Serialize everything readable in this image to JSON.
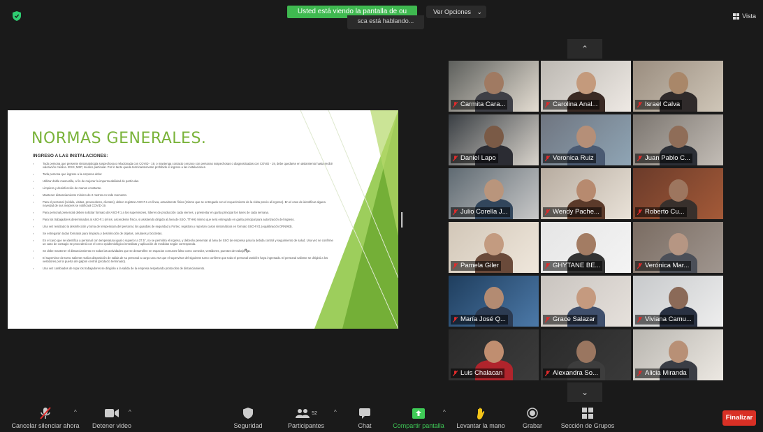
{
  "top": {
    "share_banner": "Usted está viendo la pantalla de ou",
    "share_sub": "sca está hablando...",
    "view_options": "Ver Opciones",
    "view": "Vista"
  },
  "slide": {
    "title": "NORMAS GENERALES.",
    "subtitle": "INGRESO A LAS INSTALACIONES:",
    "bullets": [
      "Todo persona que presente sintomatología sospechosa o relacionada con COVID - 19, o mantenga contacto cercano con personas sospechosas o diagnosticadas con COVID - 19, debe quedarse en aislamiento hasta recibir valoración médica. IESS, MSP, médico particular. Por lo tanto queda terminantemente prohibido el ingreso a las instalaciones.",
      "Toda persona que ingrese a la empresa debe:",
      "Utilizar doble mascarilla, a fin de mejorar la impermeabilidad de partículas.",
      "Limpieza y desinfección de manos constante.",
      "Mantener distanciamiento mínimo de 2 metros en todo momento.",
      "Para el personal (cédula, visitas, proveedores, clientes), deben registrar ASO-F.1 en línea, actualmente físico (mismo que se entregado con el requerimiento de la visita previo al ingreso). En el caso de identificar alguna novedad de sus mejores se notificará COVID-19.",
      "Para personal presencial deben solicitar formato del ASO-F.1 a los supervisores, líderes de producción cada viernes, y presentar en garita principal los lunes de cada semana.",
      "Para los trabajadores determinados al ASO-F.1 (el ins. ascendente físico, si asistiendo dirigido al área de SSO, TTHH) mismo que será entregado en garita principal para autorización del ingreso.",
      "Una vez realizado la desinfección y toma de temperatura del personal, los guardias de seguridad y Fortec, registran y reportan casos sintomáticos en formato SSO-F.01 (equilibración DRN993).",
      "Se entregarán todas formatos para limpieza y desinfección de objetos, celulares y bicicletas.",
      "En el caso que se identifica a personal con temperatura igual o superior a 37.5°, no se permitirá el ingreso, y deberán presentar al área de SSO de empresa para la debida control y seguimiento de salud. Una vez se confirme un caso de contagio se procederá con el cerco epidemiológico inmediato y aplicación de medidas según corresponda.",
      "Se debe mantener el distanciamiento en todas las actividades que se desarrollen en espacios comunes falso como comedor, vestidores, puestos de trabajo, etc.",
      "El supervisor de turno saliente realiza disposición de salida de su personal a cargo una vez que el supervisor del siguiente turno confirme que todo el personal también haya ingresado. El personal saliente se dirigirá a los vestidores por la puerta del galpón central (producto terminado).",
      "Una vez cambiados de ropa los trabajadores se dirigirán a la salida de la empresa respetando protocolos de distanciamiento."
    ]
  },
  "participants": [
    {
      "name": "Carmita Cara..."
    },
    {
      "name": "Carolina Anal..."
    },
    {
      "name": "Israel Calva"
    },
    {
      "name": "Daniel Lapo"
    },
    {
      "name": "Veronica Ruiz"
    },
    {
      "name": "Juan Pablo C..."
    },
    {
      "name": "Julio Corella J..."
    },
    {
      "name": "Wendy Pache..."
    },
    {
      "name": "Roberto Cu..."
    },
    {
      "name": "Pamela Giler"
    },
    {
      "name": "GHYTANE BE..."
    },
    {
      "name": "Verónica Mar..."
    },
    {
      "name": "María José Q..."
    },
    {
      "name": "Grace Salazar"
    },
    {
      "name": "Viviana Camu..."
    },
    {
      "name": "Luis Chalacan"
    },
    {
      "name": "Alexandra So..."
    },
    {
      "name": "Alicia Miranda"
    }
  ],
  "toolbar": {
    "unmute": "Cancelar silenciar ahora",
    "stop_video": "Detener video",
    "security": "Seguridad",
    "participants": "Participantes",
    "participants_count": "52",
    "chat": "Chat",
    "share": "Compartir pantalla",
    "raise_hand": "Levantar la mano",
    "record": "Grabar",
    "breakout": "Sección de Grupos",
    "end": "Finalizar"
  }
}
